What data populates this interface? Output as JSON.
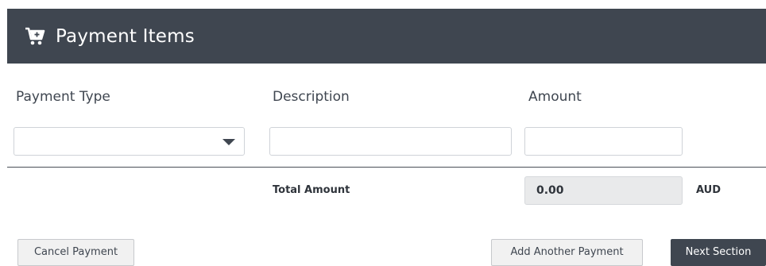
{
  "header": {
    "title": "Payment Items",
    "icon": "cart-plus-icon"
  },
  "columns": {
    "payment_type": "Payment Type",
    "description": "Description",
    "amount": "Amount"
  },
  "row": {
    "payment_type_value": "",
    "description_value": "",
    "amount_value": ""
  },
  "totals": {
    "label": "Total Amount",
    "value": "0.00",
    "currency": "AUD"
  },
  "buttons": {
    "cancel": "Cancel Payment",
    "add_another": "Add Another Payment",
    "next": "Next Section"
  },
  "colors": {
    "header_bg": "#3f4650",
    "primary_button_bg": "#3f4650",
    "secondary_button_bg": "#f1f1f1",
    "readonly_field_bg": "#e9eaeb"
  }
}
